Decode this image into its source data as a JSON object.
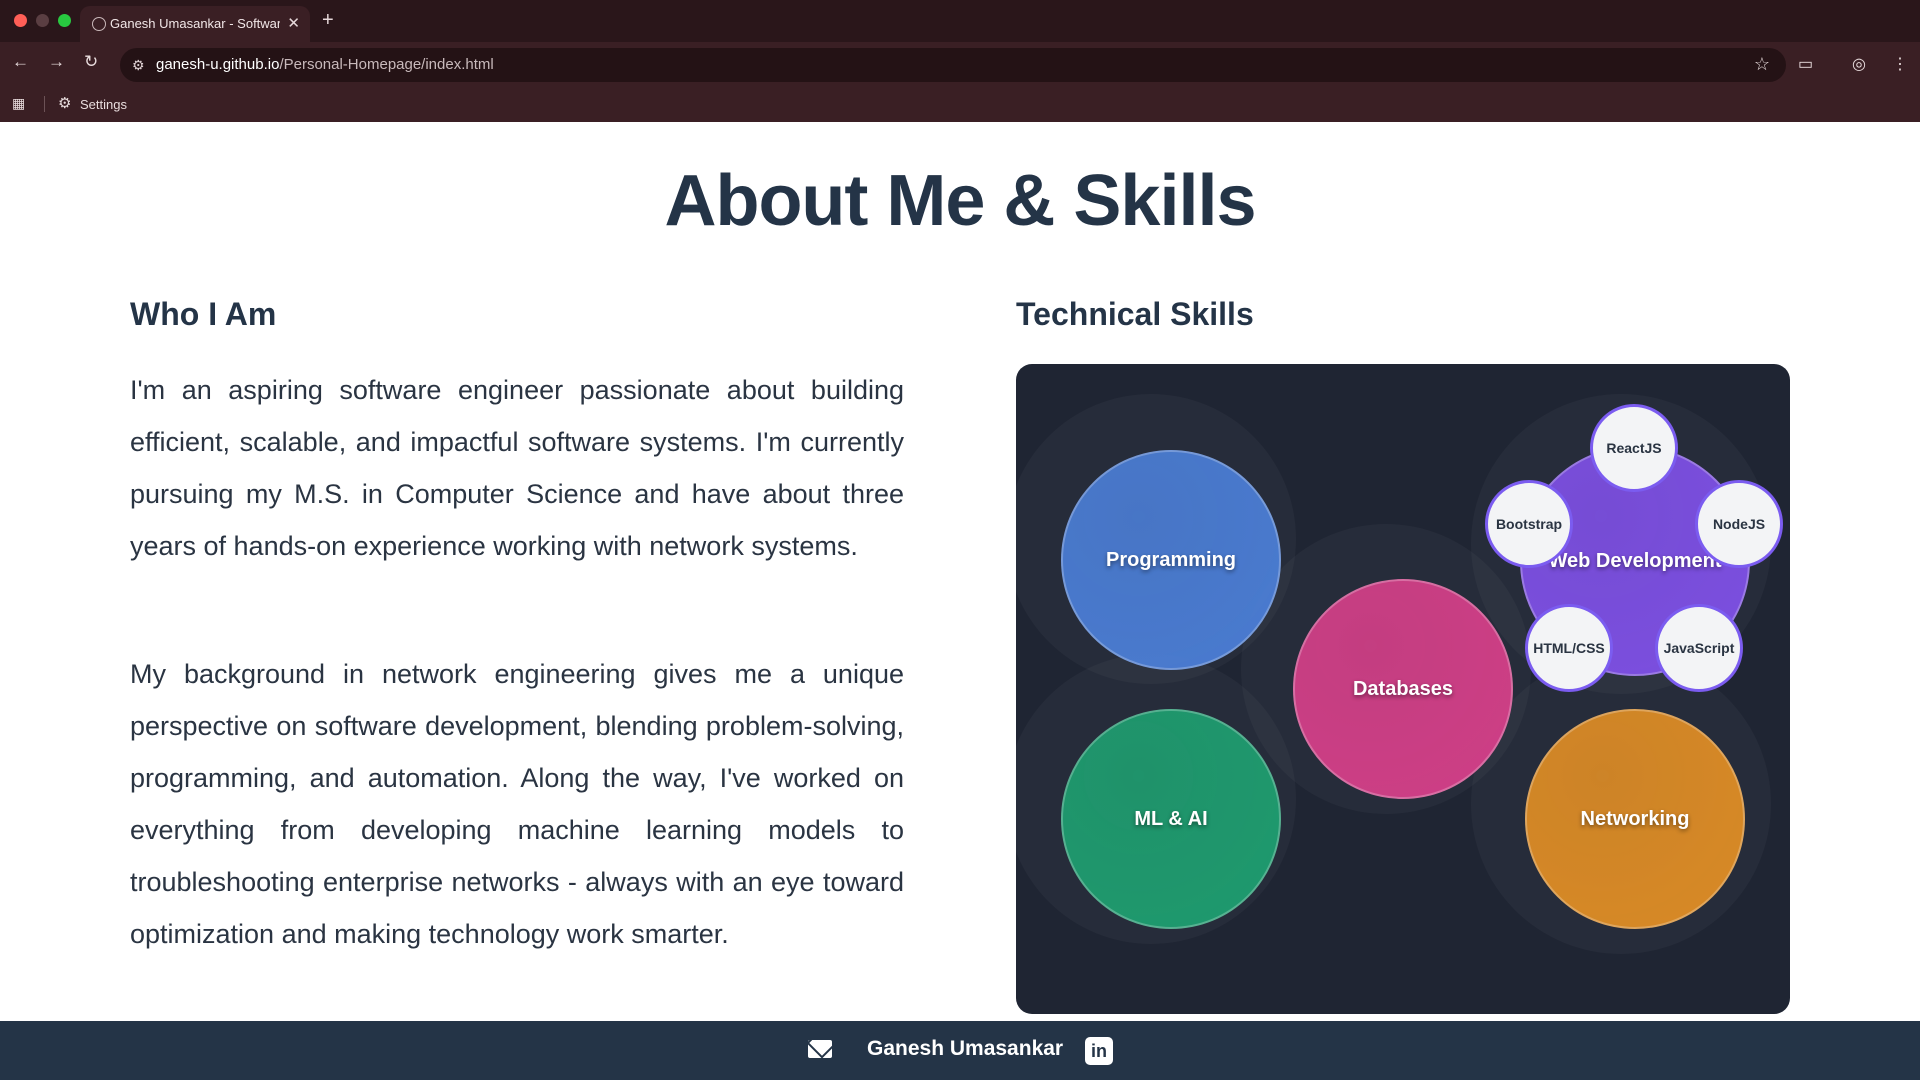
{
  "browser": {
    "tab_title": "Ganesh Umasankar - Software Engineer",
    "tab_close": "✕",
    "new_tab": "+",
    "url_host": "ganesh-u.github.io",
    "url_path": "/Personal-Homepage/index.html",
    "bookmark_settings": "Settings",
    "icons": {
      "back": "←",
      "forward": "→",
      "reload": "↻",
      "site_info": "⚙",
      "star": "☆",
      "cast": "▭",
      "profile": "◎",
      "menu": "⋮",
      "apps": "▦",
      "gear": "⚙"
    }
  },
  "page": {
    "title": "About Me & Skills",
    "who_heading": "Who I Am",
    "paragraph_1": "I'm an aspiring software engineer passionate about building efficient, scalable, and impactful software systems. I'm currently pursuing my M.S. in Computer Science and have about three years of hands-on experience working with network systems.",
    "paragraph_2": "My background in network engineering gives me a unique perspective on software development, blending problem-solving, programming, and automation. Along the way, I've worked on everything from developing machine learning models to troubleshooting enterprise networks - always with an eye toward optimization and making technology work smarter.",
    "skills_heading": "Technical Skills"
  },
  "skills": {
    "programming": "Programming",
    "web": "Web Development",
    "databases": "Databases",
    "ml": "ML & AI",
    "networking": "Networking",
    "web_sub": {
      "reactjs": "ReactJS",
      "bootstrap": "Bootstrap",
      "nodejs": "NodeJS",
      "htmlcss": "HTML/CSS",
      "javascript": "JavaScript"
    },
    "colors": {
      "programming": "#4a7bd0",
      "web": "#7c4fe0",
      "databases": "#cf3f86",
      "ml": "#1f9a6e",
      "networking": "#d98a26",
      "panel": "#1f2533"
    }
  },
  "footer": {
    "name": "Ganesh Umasankar",
    "linkedin_glyph": "in"
  }
}
